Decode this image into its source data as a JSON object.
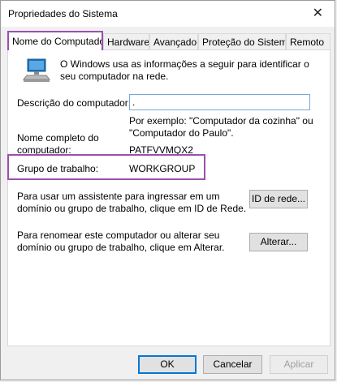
{
  "window": {
    "title": "Propriedades do Sistema",
    "close_glyph": "✕"
  },
  "tabs": [
    "Nome do Computador",
    "Hardware",
    "Avançado",
    "Proteção do Sistema",
    "Remoto"
  ],
  "panel": {
    "intro": "O Windows usa as informações a seguir para identificar o seu computador na rede.",
    "description_label": "Descrição do computador:",
    "description_value": ".",
    "example_text": "Por exemplo: \"Computador da cozinha\" ou \"Computador do Paulo\".",
    "full_name_label": "Nome completo do computador:",
    "full_name_value": "PATFVVMQX2",
    "workgroup_label": "Grupo de trabalho:",
    "workgroup_value": "WORKGROUP",
    "network_id_text": "Para usar um assistente para ingressar em um domínio ou grupo de trabalho, clique em ID de Rede.",
    "network_id_button": "ID de rede...",
    "rename_text": "Para renomear este computador ou alterar seu domínio ou grupo de trabalho, clique em Alterar.",
    "rename_button": "Alterar..."
  },
  "buttons": {
    "ok": "OK",
    "cancel": "Cancelar",
    "apply": "Aplicar"
  },
  "icons": {
    "computer": "computer-monitor-icon",
    "close": "close-icon"
  },
  "colors": {
    "highlight": "#9b4fb0",
    "focus": "#0078d7"
  }
}
